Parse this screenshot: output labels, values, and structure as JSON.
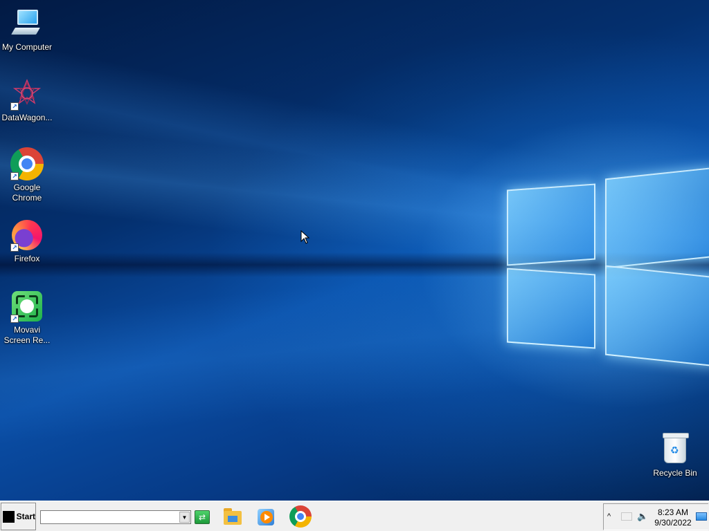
{
  "desktop": {
    "icons": [
      {
        "label": "My Computer",
        "icon": "computer-icon"
      },
      {
        "label": "DataWagon...",
        "icon": "datawagon-icon"
      },
      {
        "label": "Google\nChrome",
        "icon": "chrome-icon"
      },
      {
        "label": "Firefox",
        "icon": "firefox-icon"
      },
      {
        "label": "Movavi\nScreen Re...",
        "icon": "movavi-icon"
      },
      {
        "label": "Recycle Bin",
        "icon": "recycle-bin-icon"
      }
    ]
  },
  "taskbar": {
    "start_label": "Start",
    "run_input_value": "",
    "go_icon": "go-icon",
    "pinned_apps": [
      {
        "name": "File Explorer",
        "icon": "folder-icon"
      },
      {
        "name": "Media Player",
        "icon": "media-player-icon"
      },
      {
        "name": "Google Chrome",
        "icon": "chrome-icon"
      }
    ]
  },
  "tray": {
    "chevron": "^",
    "time": "8:23 AM",
    "date": "9/30/2022",
    "icons": [
      "network-icon",
      "volume-icon",
      "show-desktop-icon"
    ]
  },
  "colors": {
    "taskbar_bg": "#f0f0f0",
    "wallpaper_accent": "#0a4ea6"
  }
}
